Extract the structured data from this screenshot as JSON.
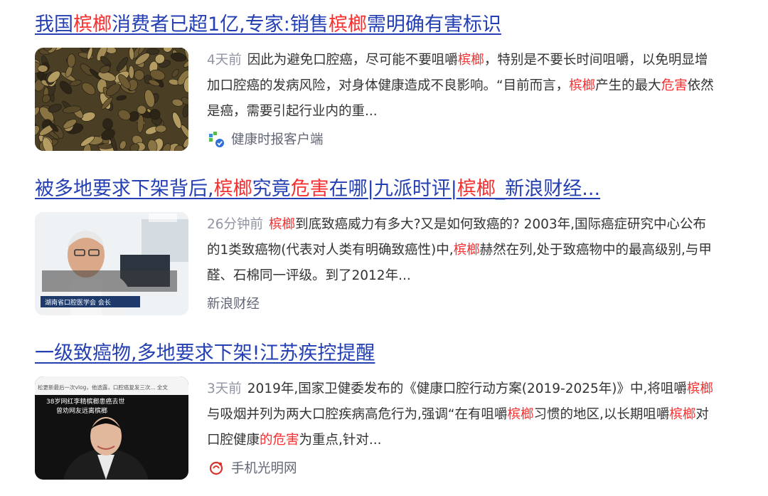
{
  "results": [
    {
      "title": [
        {
          "t": "我国"
        },
        {
          "t": "槟榔",
          "hl": true
        },
        {
          "t": "消费者已超1亿,专家:销售"
        },
        {
          "t": "槟榔",
          "hl": true
        },
        {
          "t": "需明确有害标识"
        }
      ],
      "thumb_icon": "betel-nut-photo",
      "time": "4天前",
      "abstract": [
        {
          "t": "因此为避免口腔癌，尽可能不要咀嚼"
        },
        {
          "t": "槟榔",
          "hl": true
        },
        {
          "t": "，特别是不要长时间咀嚼，以免明显增加口腔癌的发病风险，对身体健康造成不良影响。“目前而言，"
        },
        {
          "t": "槟榔",
          "hl": true
        },
        {
          "t": "产生的最大"
        },
        {
          "t": "危害",
          "hl": true
        },
        {
          "t": "依然是癌，需要引起行业内的重..."
        }
      ],
      "source": "健康时报客户端",
      "source_icon": "jiankang-shibao-logo-icon"
    },
    {
      "title": [
        {
          "t": "被多地要求下架背后,"
        },
        {
          "t": "槟榔",
          "hl": true
        },
        {
          "t": "究竟"
        },
        {
          "t": "危害",
          "hl": true
        },
        {
          "t": "在哪|九派时评|"
        },
        {
          "t": "槟榔",
          "hl": true
        },
        {
          "t": "_新浪财经..."
        }
      ],
      "thumb_icon": "doctor-interview-video-frame",
      "time": "26分钟前",
      "abstract": [
        {
          "t": "槟榔",
          "hl": true
        },
        {
          "t": "到底致癌威力有多大?又是如何致癌的? 2003年,国际癌症研究中心公布的1类致癌物(代表对人类有明确致癌性)中,"
        },
        {
          "t": "槟榔",
          "hl": true
        },
        {
          "t": "赫然在列,处于致癌物中的最高级别,与甲醛、石棉同一评级。到了2012年..."
        }
      ],
      "source": "新浪财经",
      "source_icon": ""
    },
    {
      "title": [
        {
          "t": "一级致癌物,多地要求下架!江苏疾控提醒"
        }
      ],
      "thumb_icon": "social-post-screenshot",
      "time": "3天前",
      "abstract": [
        {
          "t": "2019年,国家卫健委发布的《健康口腔行动方案(2019-2025年)》中,将咀嚼"
        },
        {
          "t": "槟榔",
          "hl": true
        },
        {
          "t": "与吸烟并列为两大口腔疾病高危行为,强调“在有咀嚼"
        },
        {
          "t": "槟榔",
          "hl": true
        },
        {
          "t": "习惯的地区,以长期咀嚼"
        },
        {
          "t": "槟榔",
          "hl": true
        },
        {
          "t": "对口腔健康"
        },
        {
          "t": "的危害",
          "hl": true
        },
        {
          "t": "为重点,针对..."
        }
      ],
      "source": "手机光明网",
      "source_icon": "guangming-logo-icon"
    }
  ],
  "thumb_texts": {
    "r2_caption": "湖南省口腔医学会 会长",
    "r3_overlay_1": "松更新最后一次vlog，他透露，口腔癌复发三次... 全文",
    "r3_overlay_2": "38岁网红李精槟榔患癌去世",
    "r3_overlay_3": "曾劝网友远离槟榔"
  },
  "colors": {
    "title_link": "#2440b3",
    "highlight": "#f73131",
    "body_text": "#333333",
    "time_text": "#9195a3",
    "source_text": "#626675"
  }
}
